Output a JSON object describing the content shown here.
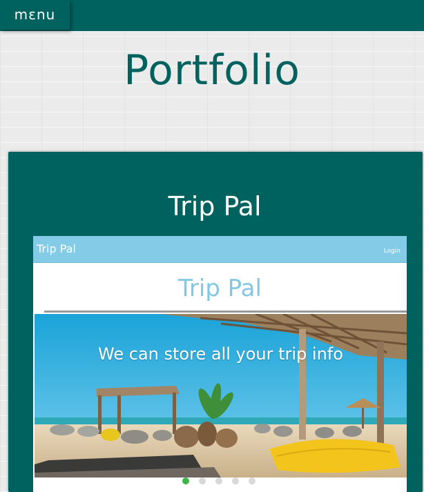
{
  "nav": {
    "menu_label": "mɛnu"
  },
  "page": {
    "title": "Portfolio"
  },
  "project": {
    "title": "Trip Pal",
    "screenshot": {
      "brand": "Trip Pal",
      "login": "Login",
      "title": "Trip Pal",
      "hero_caption": "We can store all your trip info",
      "carousel": {
        "count": 5,
        "active": 1
      }
    }
  },
  "colors": {
    "brand_teal": "#00625f",
    "tripnav_blue": "#83cbe6",
    "active_dot": "#3cb54a",
    "inactive_dot": "#d8d8d8"
  }
}
